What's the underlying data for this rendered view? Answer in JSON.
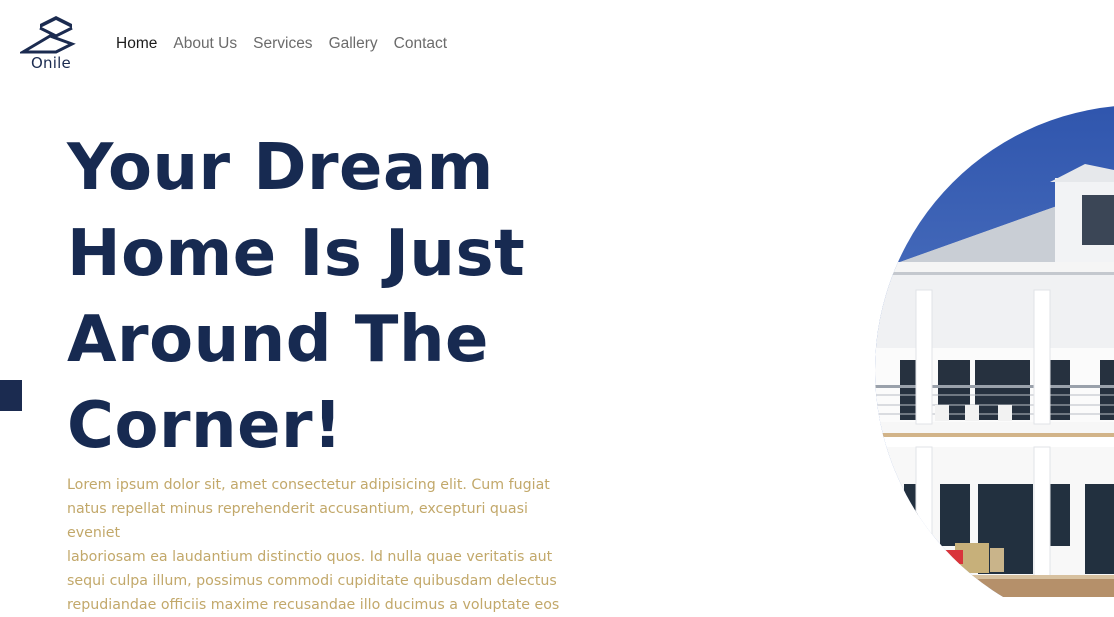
{
  "brand": {
    "name": "Onile"
  },
  "nav": {
    "items": [
      {
        "label": "Home",
        "active": true
      },
      {
        "label": "About Us",
        "active": false
      },
      {
        "label": "Services",
        "active": false
      },
      {
        "label": "Gallery",
        "active": false
      },
      {
        "label": "Contact",
        "active": false
      }
    ]
  },
  "hero": {
    "title": "Your Dream Home Is Just Around The Corner!",
    "title_lines": [
      "Your Dream",
      "Home Is Just",
      "Around The",
      "Corner!"
    ],
    "description": "Lorem ipsum dolor sit, amet consectetur adipisicing elit. Cum fugiat natus repellat minus reprehenderit accusantium, excepturi quasi eveniet laboriosam ea laudantium distinctio quos. Id nulla quae veritatis aut sequi culpa illum, possimus commodi cupiditate quibusdam delectus repudiandae officiis maxime recusandae illo ducimus a voluptate eos",
    "description_lines": [
      "Lorem ipsum dolor sit, amet consectetur adipisicing elit. Cum fugiat",
      "natus repellat minus reprehenderit accusantium, excepturi quasi eveniet",
      "laboriosam ea laudantium distinctio quos. Id nulla quae veritatis aut",
      "sequi culpa illum, possimus commodi cupiditate quibusdam delectus",
      "repudiandae officiis maxime recusandae illo ducimus a voluptate eos"
    ],
    "image_icon": "house-photo"
  },
  "colors": {
    "primary": "#172a51",
    "accent_text": "#c2a86a",
    "nav_text": "#6b6b6b",
    "nav_active": "#1c1c1c",
    "sky": "#3f63b6"
  }
}
